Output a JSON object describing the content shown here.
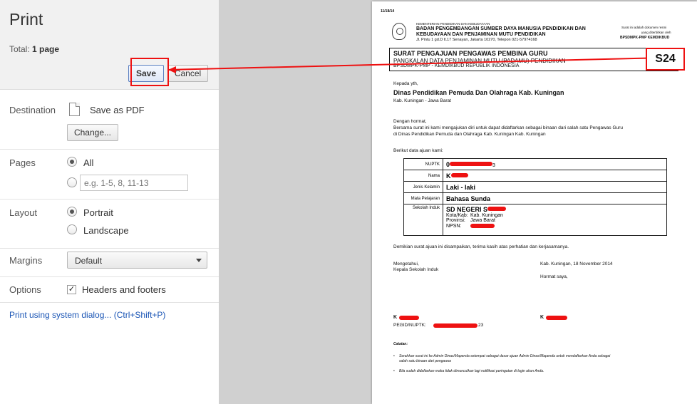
{
  "panel": {
    "title": "Print",
    "total_label": "Total:",
    "total_value": "1 page",
    "save_label": "Save",
    "cancel_label": "Cancel",
    "destination": {
      "label": "Destination",
      "value": "Save as PDF",
      "change_label": "Change..."
    },
    "pages": {
      "label": "Pages",
      "all_label": "All",
      "custom_placeholder": "e.g. 1-5, 8, 11-13"
    },
    "layout": {
      "label": "Layout",
      "portrait_label": "Portrait",
      "landscape_label": "Landscape"
    },
    "margins": {
      "label": "Margins",
      "selected": "Default"
    },
    "options": {
      "label": "Options",
      "headers_footers_label": "Headers and footers"
    },
    "system_dialog_link": "Print using system dialog... (Ctrl+Shift+P)"
  },
  "document": {
    "date": "11/18/14",
    "ministry": "KEMENTERIAN PENDIDIKAN DAN KEBUDAYAAN",
    "agency_line1": "BADAN PENGEMBANGAN SUMBER DAYA MANUSIA PENDIDIKAN DAN",
    "agency_line2": "KEBUDAYAAN DAN PENJAMINAN MUTU PENDIDIKAN",
    "address": "Jl. Pintu 1 gd.D lt.17 Senayan, Jakarta 10270, Telepon 021-57974168",
    "note_line1": "Surat ini adalah dokumen resmi",
    "note_line2": "yang diterbitkan oleh",
    "note_line3": "BPSDMPK-PMP KEMDIKBUD",
    "letter_title": "SURAT PENGAJUAN PENGAWAS PEMBINA GURU",
    "letter_subtitle1": "PANGKALAN DATA PENJAMINAN MUTU (PADAMU) PENDIDIKAN",
    "letter_subtitle2": "BPSDMPK-PMP - KEMDIKBUD REPUBLIK INDONESIA",
    "code": "S24",
    "to_label": "Kepada yth,",
    "to_name": "Dinas Pendidikan Pemuda Dan Olahraga Kab. Kuningan",
    "to_location": "Kab. Kuningan - Jawa Barat",
    "greeting": "Dengan hormat,",
    "body_line1": "Bersama surat ini kami mengajukan diri untuk dapat didaftarkan sebagai binaan dari salah satu Pengawas Guru",
    "body_line2": "di Dinas Pendidikan Pemuda dan Olahraga Kab. Kuningan Kab. Kuningan",
    "data_intro": "Berikut data ajuan kami:",
    "table": [
      {
        "key": "NUPTK",
        "value": "0"
      },
      {
        "key": "Nama",
        "value": "K"
      },
      {
        "key": "Jenis Kelamin",
        "value": "Laki - laki"
      },
      {
        "key": "Mata Pelajaran",
        "value": "Bahasa Sunda"
      }
    ],
    "school_key": "Sekolah Induk",
    "school_name": "SD NEGERI S",
    "school_kota_label": "Kota/Kab:",
    "school_kota_value": "Kab. Kuningan",
    "school_prov_label": "Provinsi:",
    "school_prov_value": "Jawa Barat",
    "school_npsn_label": "NPSN:",
    "closing": "Demikian surat ajuan ini disampaikan, terima kasih atas perhatian dan kerjasamanya.",
    "known_label": "Mengetahui,",
    "head_label": "Kepala Sekolah Induk",
    "place_date": "Kab. Kuningan, 18 November 2014",
    "regards": "Hormat saya,",
    "sign_left": "K",
    "sign_right": "K",
    "pegid_label": "PEGID/NUPTK:",
    "pegid_tail": "23",
    "nuptk_tail": "3",
    "notes_title": "Catatan:",
    "note1_line1": "Serahkan surat ini ke Admin Dinas/Mapenda setempat sebagai dasar ajuan Admin Dinas/Mapenda untuk mendaftarkan Anda sebagai",
    "note1_line2": "salah satu binaan dari pengawas",
    "note2": "Bila sudah didaftarkan maka tidak dimunculkan lagi notifikasi peringatan di login akun Anda."
  },
  "colors": {
    "annotation": "#ee1111",
    "link": "#1a55b5"
  }
}
